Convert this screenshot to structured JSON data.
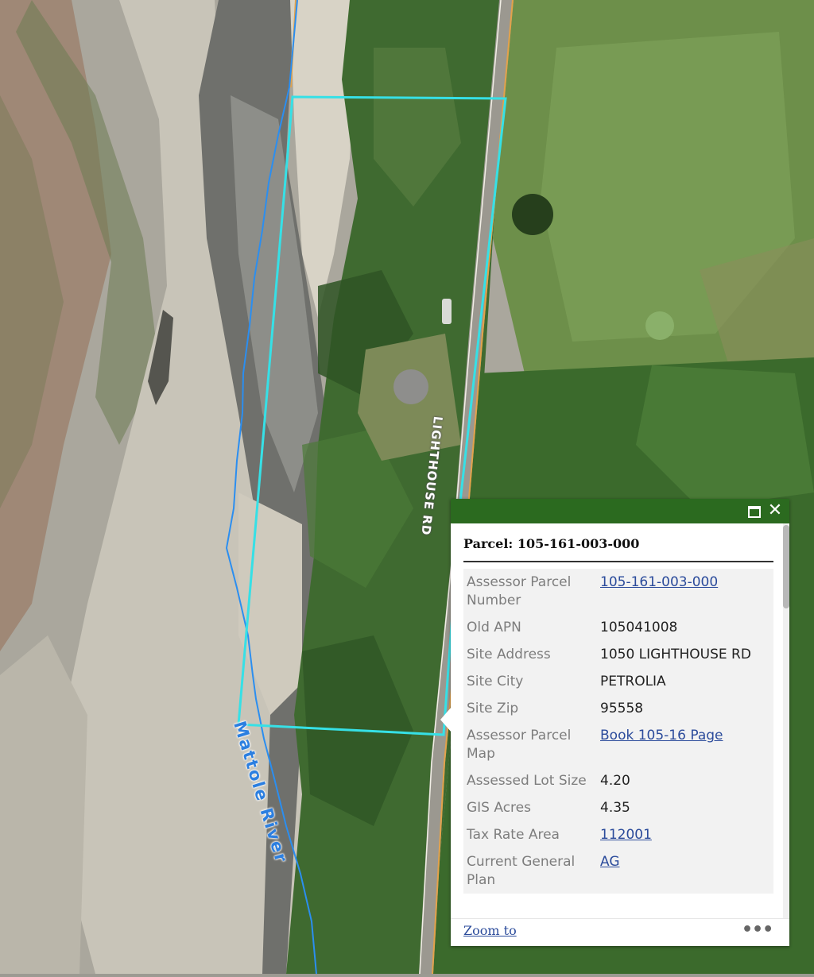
{
  "map": {
    "road_label": "LIGHTHOUSE RD",
    "river_label": "Mattole River",
    "colors": {
      "parcel_outline": "#36e0e6",
      "river_line": "#2b8ef0",
      "road_edge": "#e3a24a"
    }
  },
  "popup": {
    "header_color": "#2b6a1f",
    "maximize_icon": "maximize-icon",
    "close_icon": "✕",
    "title": "Parcel: 105-161-003-000",
    "attributes": [
      {
        "field": "Assessor Parcel Number",
        "value": "105-161-003-000",
        "link": true
      },
      {
        "field": "Old APN",
        "value": "105041008",
        "link": false
      },
      {
        "field": "Site Address",
        "value": "1050 LIGHTHOUSE RD",
        "link": false
      },
      {
        "field": "Site City",
        "value": "PETROLIA",
        "link": false
      },
      {
        "field": "Site Zip",
        "value": "95558",
        "link": false
      },
      {
        "field": "Assessor Parcel Map",
        "value": "Book 105-16 Page",
        "link": true
      },
      {
        "field": "Assessed Lot Size",
        "value": "4.20",
        "link": false
      },
      {
        "field": "GIS Acres",
        "value": "4.35",
        "link": false
      },
      {
        "field": "Tax Rate Area",
        "value": "112001",
        "link": true
      },
      {
        "field": "Current General Plan",
        "value": "AG",
        "link": true
      }
    ],
    "footer": {
      "zoom_label": "Zoom to",
      "more_icon": "•••"
    }
  }
}
